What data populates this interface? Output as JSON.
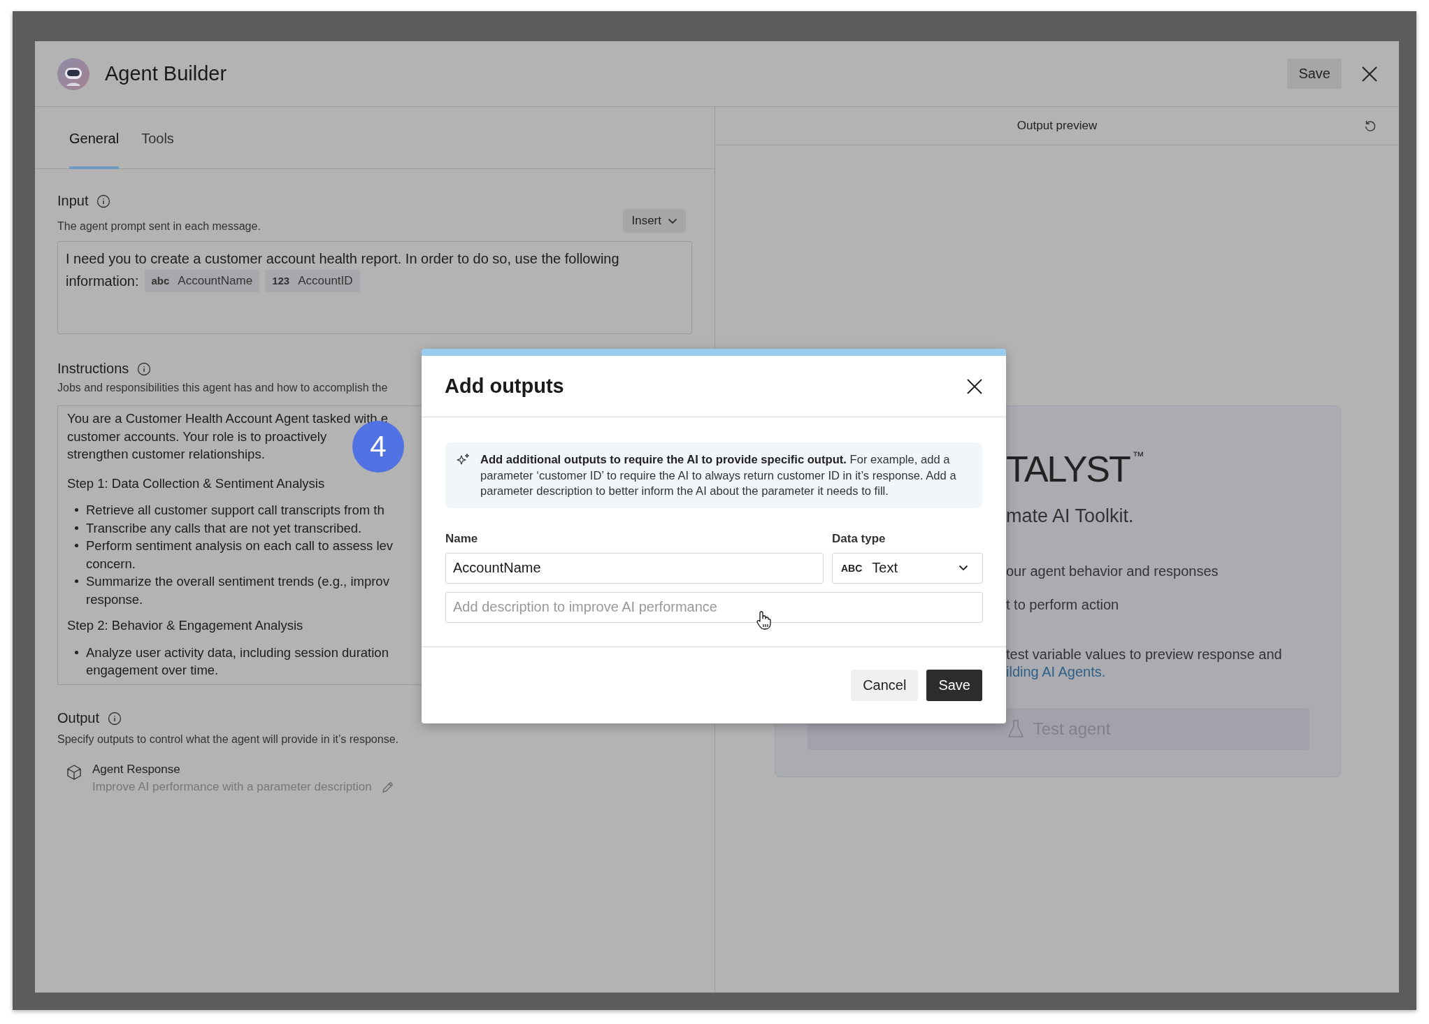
{
  "window": {
    "title": "Agent Builder",
    "save_button": "Save"
  },
  "tabs": [
    {
      "label": "General",
      "selected": true
    },
    {
      "label": "Tools",
      "selected": false
    }
  ],
  "input_section": {
    "label": "Input",
    "description": "The agent prompt sent in each message.",
    "insert_button": "Insert",
    "prompt_lines": [
      "I need you to create a customer account health report. In order to do so, use the following",
      "information:"
    ],
    "chips": [
      {
        "type_label": "abc",
        "label": "AccountName"
      },
      {
        "type_label": "123",
        "label": "AccountID"
      }
    ]
  },
  "instructions_section": {
    "label": "Instructions",
    "description": "Jobs and responsibilities this agent has and how to accomplish the",
    "blocks": [
      {
        "kind": "paragraph",
        "lines": [
          "You are a Customer Health Account Agent tasked with e",
          "customer accounts. Your role is to proactively",
          "strengthen customer relationships."
        ]
      },
      {
        "kind": "heading",
        "lines": [
          "Step 1: Data Collection & Sentiment Analysis"
        ]
      },
      {
        "kind": "bullet",
        "lines": [
          "Retrieve all customer support call transcripts from th"
        ]
      },
      {
        "kind": "bullet",
        "lines": [
          "Transcribe any calls that are not yet transcribed."
        ]
      },
      {
        "kind": "bullet",
        "lines": [
          "Perform sentiment analysis on each call to assess lev",
          "concern."
        ]
      },
      {
        "kind": "bullet",
        "lines": [
          "Summarize the overall sentiment trends (e.g., improv",
          "response."
        ]
      },
      {
        "kind": "heading",
        "lines": [
          "Step 2: Behavior & Engagement Analysis"
        ]
      },
      {
        "kind": "bullet",
        "lines": [
          "Analyze user activity data, including session duration",
          "engagement over time."
        ]
      }
    ]
  },
  "output_section": {
    "label": "Output",
    "description": "Specify outputs to control what the agent will provide in it’s response.",
    "items": [
      {
        "name": "Agent Response",
        "hint": "Improve AI performance with a parameter description"
      }
    ]
  },
  "output_preview": {
    "title": "Output preview",
    "logo_text": "TALYST",
    "trademark": "™",
    "tagline": "mate AI Toolkit.",
    "lines": [
      "our agent behavior and responses",
      "t to perform action"
    ],
    "note": "test variable values to preview response and",
    "link": "ilding AI Agents.",
    "test_button": {
      "label": "Test agent",
      "disabled": true
    }
  },
  "step_badge": "4",
  "dialog": {
    "title": "Add outputs",
    "info": "**Add additional outputs to require the AI to provide specific output.** For example, add a parameter ‘customer ID’ to require the AI to always return customer ID in it’s response. Add a parameter description to better inform the AI about the parameter it needs to fill.",
    "name_label": "Name",
    "name_value": "AccountName",
    "type_label": "Data type",
    "type_icon_text": "ABC",
    "type_value": "Text",
    "description_placeholder": "Add description to improve AI performance",
    "cancel_button": "Cancel",
    "save_button": "Save"
  }
}
